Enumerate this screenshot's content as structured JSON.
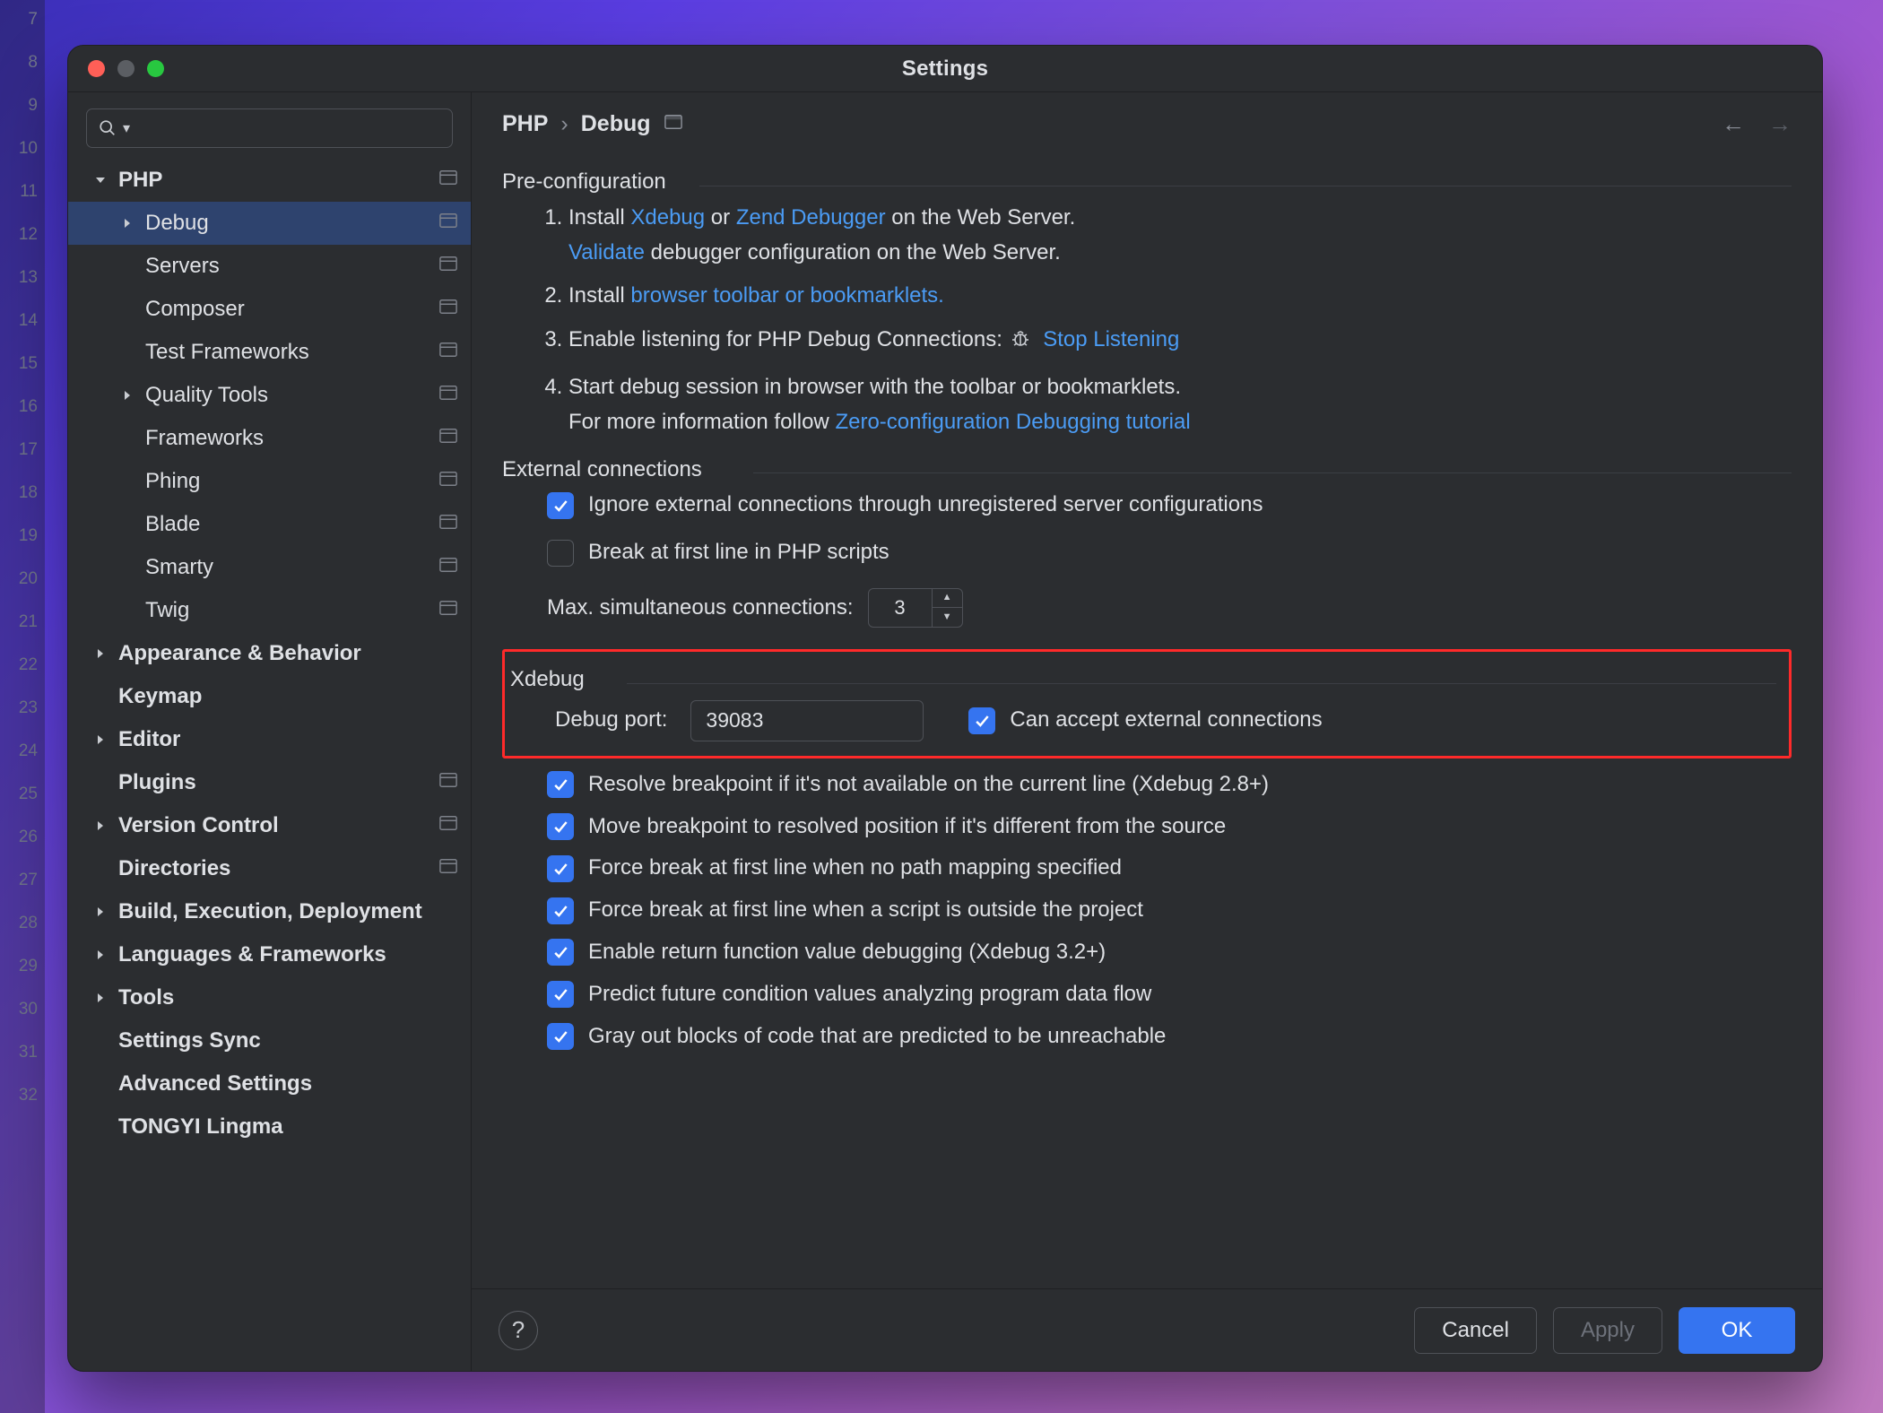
{
  "gutter_lines": [
    "7",
    "8",
    "9",
    "10",
    "11",
    "12",
    "13",
    "14",
    "15",
    "16",
    "17",
    "18",
    "19",
    "20",
    "21",
    "22",
    "23",
    "24",
    "25",
    "26",
    "27",
    "28",
    "29",
    "30",
    "31",
    "32"
  ],
  "window": {
    "title": "Settings"
  },
  "breadcrumb": {
    "root": "PHP",
    "leaf": "Debug"
  },
  "sidebar": {
    "items": [
      {
        "label": "PHP",
        "level": 0,
        "bold": true,
        "chev": "down",
        "badge": true
      },
      {
        "label": "Debug",
        "level": 1,
        "bold": false,
        "chev": "right",
        "badge": true,
        "selected": true
      },
      {
        "label": "Servers",
        "level": 1,
        "badge": true
      },
      {
        "label": "Composer",
        "level": 1,
        "badge": true
      },
      {
        "label": "Test Frameworks",
        "level": 1,
        "badge": true
      },
      {
        "label": "Quality Tools",
        "level": 1,
        "chev": "right",
        "badge": true
      },
      {
        "label": "Frameworks",
        "level": 1,
        "badge": true
      },
      {
        "label": "Phing",
        "level": 1,
        "badge": true
      },
      {
        "label": "Blade",
        "level": 1,
        "badge": true
      },
      {
        "label": "Smarty",
        "level": 1,
        "badge": true
      },
      {
        "label": "Twig",
        "level": 1,
        "badge": true
      },
      {
        "label": "Appearance & Behavior",
        "level": 0,
        "bold": true,
        "chev": "right"
      },
      {
        "label": "Keymap",
        "level": 0,
        "bold": true
      },
      {
        "label": "Editor",
        "level": 0,
        "bold": true,
        "chev": "right"
      },
      {
        "label": "Plugins",
        "level": 0,
        "bold": true,
        "badge": true
      },
      {
        "label": "Version Control",
        "level": 0,
        "bold": true,
        "chev": "right",
        "badge": true
      },
      {
        "label": "Directories",
        "level": 0,
        "bold": true,
        "badge": true
      },
      {
        "label": "Build, Execution, Deployment",
        "level": 0,
        "bold": true,
        "chev": "right"
      },
      {
        "label": "Languages & Frameworks",
        "level": 0,
        "bold": true,
        "chev": "right"
      },
      {
        "label": "Tools",
        "level": 0,
        "bold": true,
        "chev": "right"
      },
      {
        "label": "Settings Sync",
        "level": 0,
        "bold": true
      },
      {
        "label": "Advanced Settings",
        "level": 0,
        "bold": true
      },
      {
        "label": "TONGYI Lingma",
        "level": 0,
        "bold": true
      }
    ]
  },
  "sections": {
    "preconfig": {
      "title": "Pre-configuration",
      "step1a": "Install ",
      "step1_xdebug": "Xdebug",
      "step1_or": " or ",
      "step1_zend": "Zend Debugger",
      "step1b": " on the Web Server.",
      "step1_validate": "Validate",
      "step1c": " debugger configuration on the Web Server.",
      "step2a": "Install ",
      "step2_link": "browser toolbar or bookmarklets.",
      "step3a": "Enable listening for PHP Debug Connections:  ",
      "step3_link": "Stop Listening",
      "step4a": "Start debug session in browser with the toolbar or bookmarklets.",
      "step4b": "For more information follow ",
      "step4_link": "Zero-configuration Debugging tutorial"
    },
    "external": {
      "title": "External connections",
      "opt_ignore": "Ignore external connections through unregistered server configurations",
      "opt_break": "Break at first line in PHP scripts",
      "max_label": "Max. simultaneous connections:",
      "max_value": "3"
    },
    "xdebug": {
      "title": "Xdebug",
      "port_label": "Debug port:",
      "port_value": "39083",
      "accept": "Can accept external connections",
      "opt_resolve": "Resolve breakpoint if it's not available on the current line (Xdebug 2.8+)",
      "opt_move": "Move breakpoint to resolved position if it's different from the source",
      "opt_force1": "Force break at first line when no path mapping specified",
      "opt_force2": "Force break at first line when a script is outside the project",
      "opt_return": "Enable return function value debugging (Xdebug 3.2+)",
      "opt_predict": "Predict future condition values analyzing program data flow",
      "opt_gray": "Gray out blocks of code that are predicted to be unreachable"
    }
  },
  "footer": {
    "help": "?",
    "cancel": "Cancel",
    "apply": "Apply",
    "ok": "OK"
  }
}
